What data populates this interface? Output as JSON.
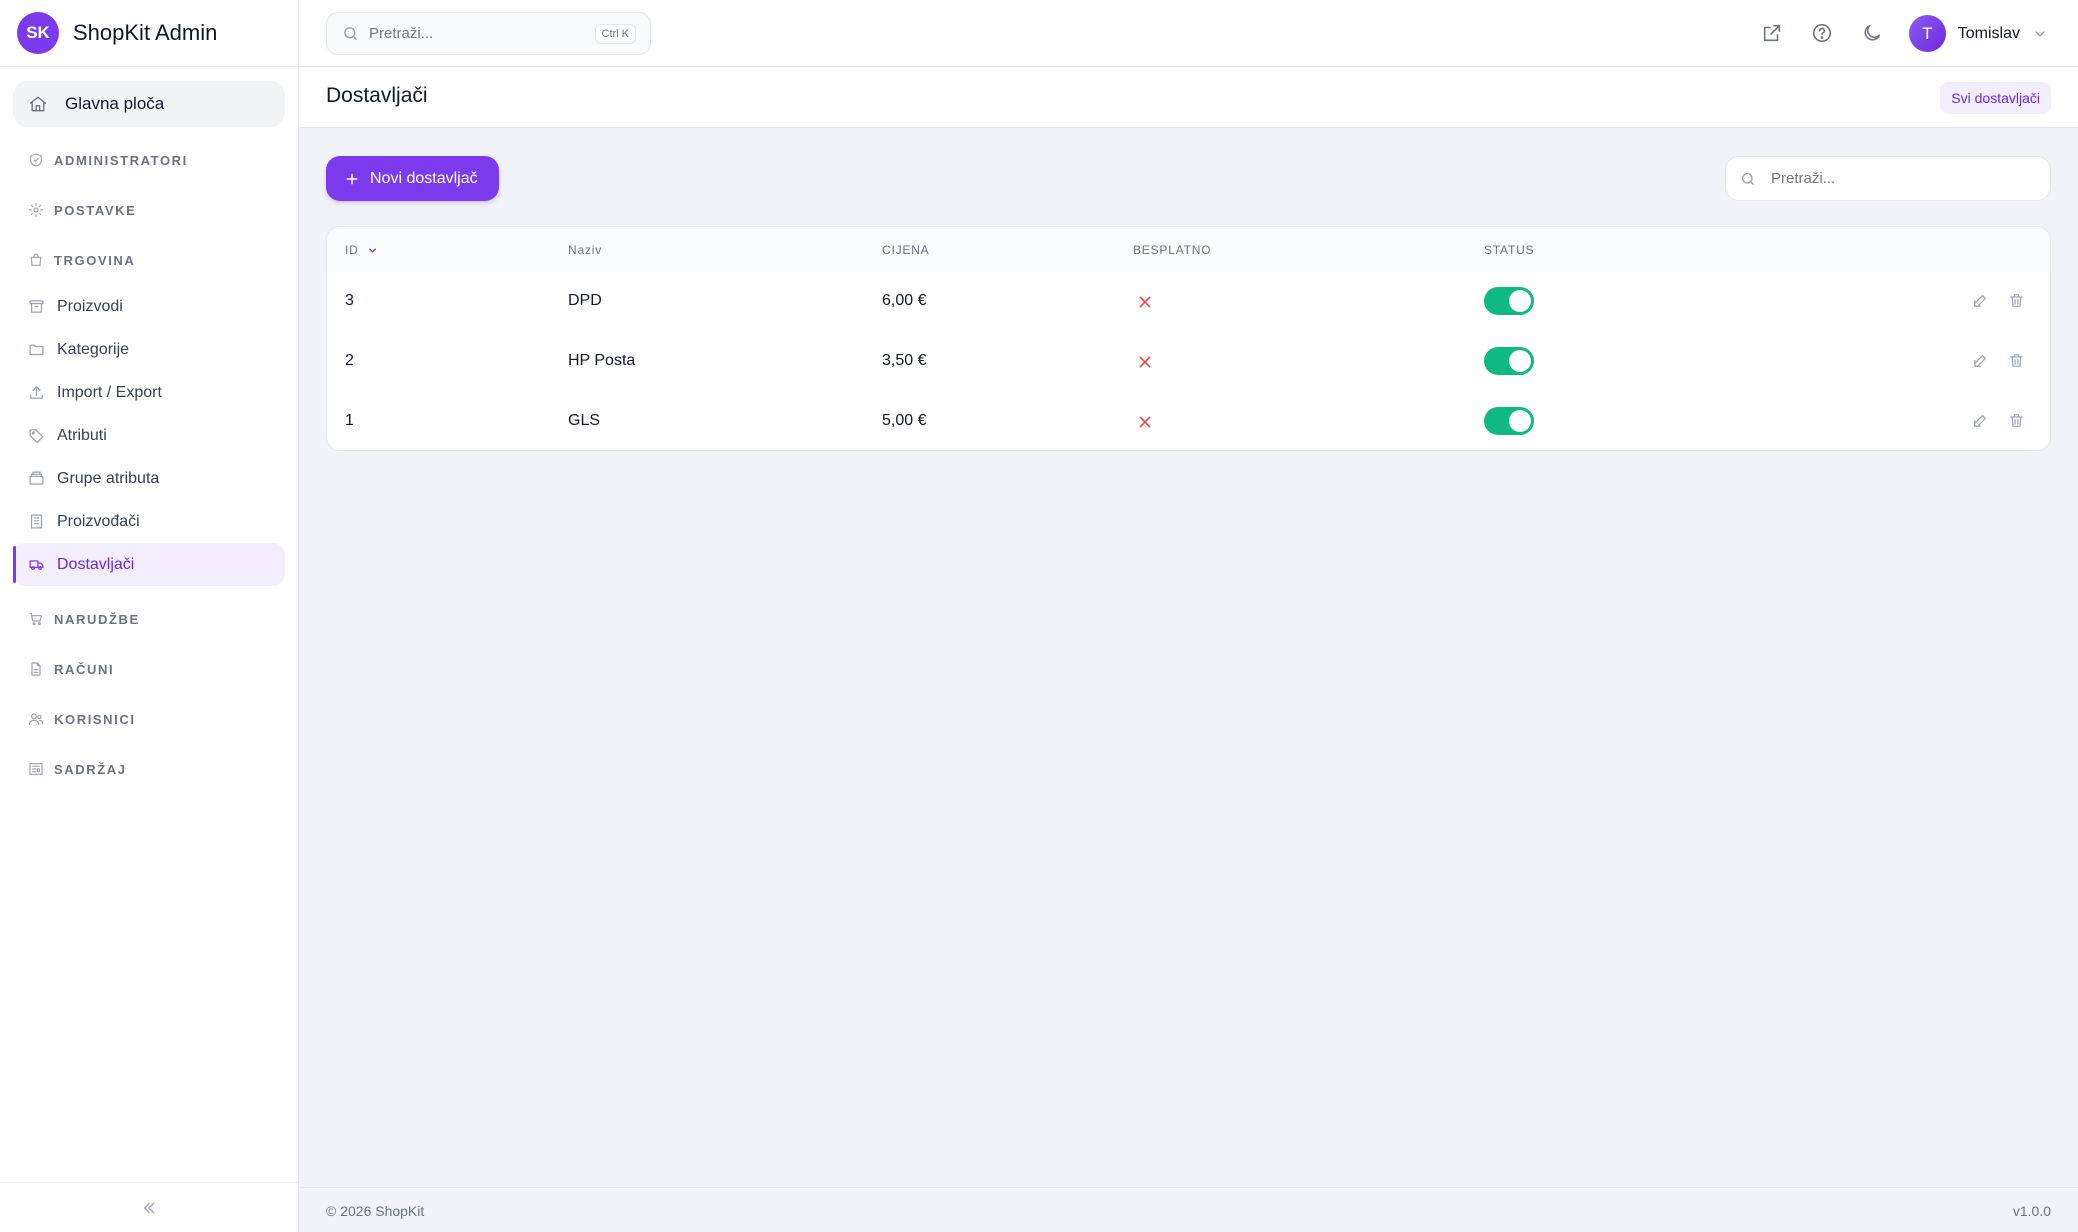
{
  "brand": {
    "initials": "SK",
    "name": "ShopKit Admin"
  },
  "sidebar": {
    "home": "Glavna ploča",
    "sections": [
      {
        "label": "ADMINISTRATORI",
        "icon": "shield-icon"
      },
      {
        "label": "POSTAVKE",
        "icon": "gear-icon"
      },
      {
        "label": "TRGOVINA",
        "icon": "shopping-bag-icon"
      }
    ],
    "shop_items": [
      {
        "label": "Proizvodi",
        "icon": "archive-icon"
      },
      {
        "label": "Kategorije",
        "icon": "folder-icon"
      },
      {
        "label": "Import / Export",
        "icon": "upload-icon"
      },
      {
        "label": "Atributi",
        "icon": "tag-icon"
      },
      {
        "label": "Grupe atributa",
        "icon": "stack-icon"
      },
      {
        "label": "Proizvođači",
        "icon": "building-icon"
      },
      {
        "label": "Dostavljači",
        "icon": "truck-icon",
        "active": true
      }
    ],
    "bottom_sections": [
      {
        "label": "NARUDŽBE",
        "icon": "cart-icon"
      },
      {
        "label": "RAČUNI",
        "icon": "document-icon"
      },
      {
        "label": "KORISNICI",
        "icon": "users-icon"
      },
      {
        "label": "SADRŽAJ",
        "icon": "newspaper-icon"
      }
    ]
  },
  "topbar": {
    "search_placeholder": "Pretraži...",
    "shortcut": "Ctrl K",
    "user": {
      "initial": "T",
      "name": "Tomislav"
    }
  },
  "page": {
    "title": "Dostavljači",
    "badge": "Svi dostavljači",
    "new_button": "Novi dostavljač",
    "search_placeholder": "Pretraži..."
  },
  "table": {
    "columns": [
      "ID",
      "Naziv",
      "CIJENA",
      "BESPLATNO",
      "STATUS"
    ],
    "rows": [
      {
        "id": "3",
        "name": "DPD",
        "price": "6,00 €",
        "free": false,
        "status": true
      },
      {
        "id": "2",
        "name": "HP Posta",
        "price": "3,50 €",
        "free": false,
        "status": true
      },
      {
        "id": "1",
        "name": "GLS",
        "price": "5,00 €",
        "free": false,
        "status": true
      }
    ]
  },
  "footer": {
    "copyright": "© 2026 ShopKit",
    "version": "v1.0.0"
  },
  "colors": {
    "accent": "#7c3aed",
    "toggle_on": "#10b981",
    "false_mark": "#ef4444"
  }
}
